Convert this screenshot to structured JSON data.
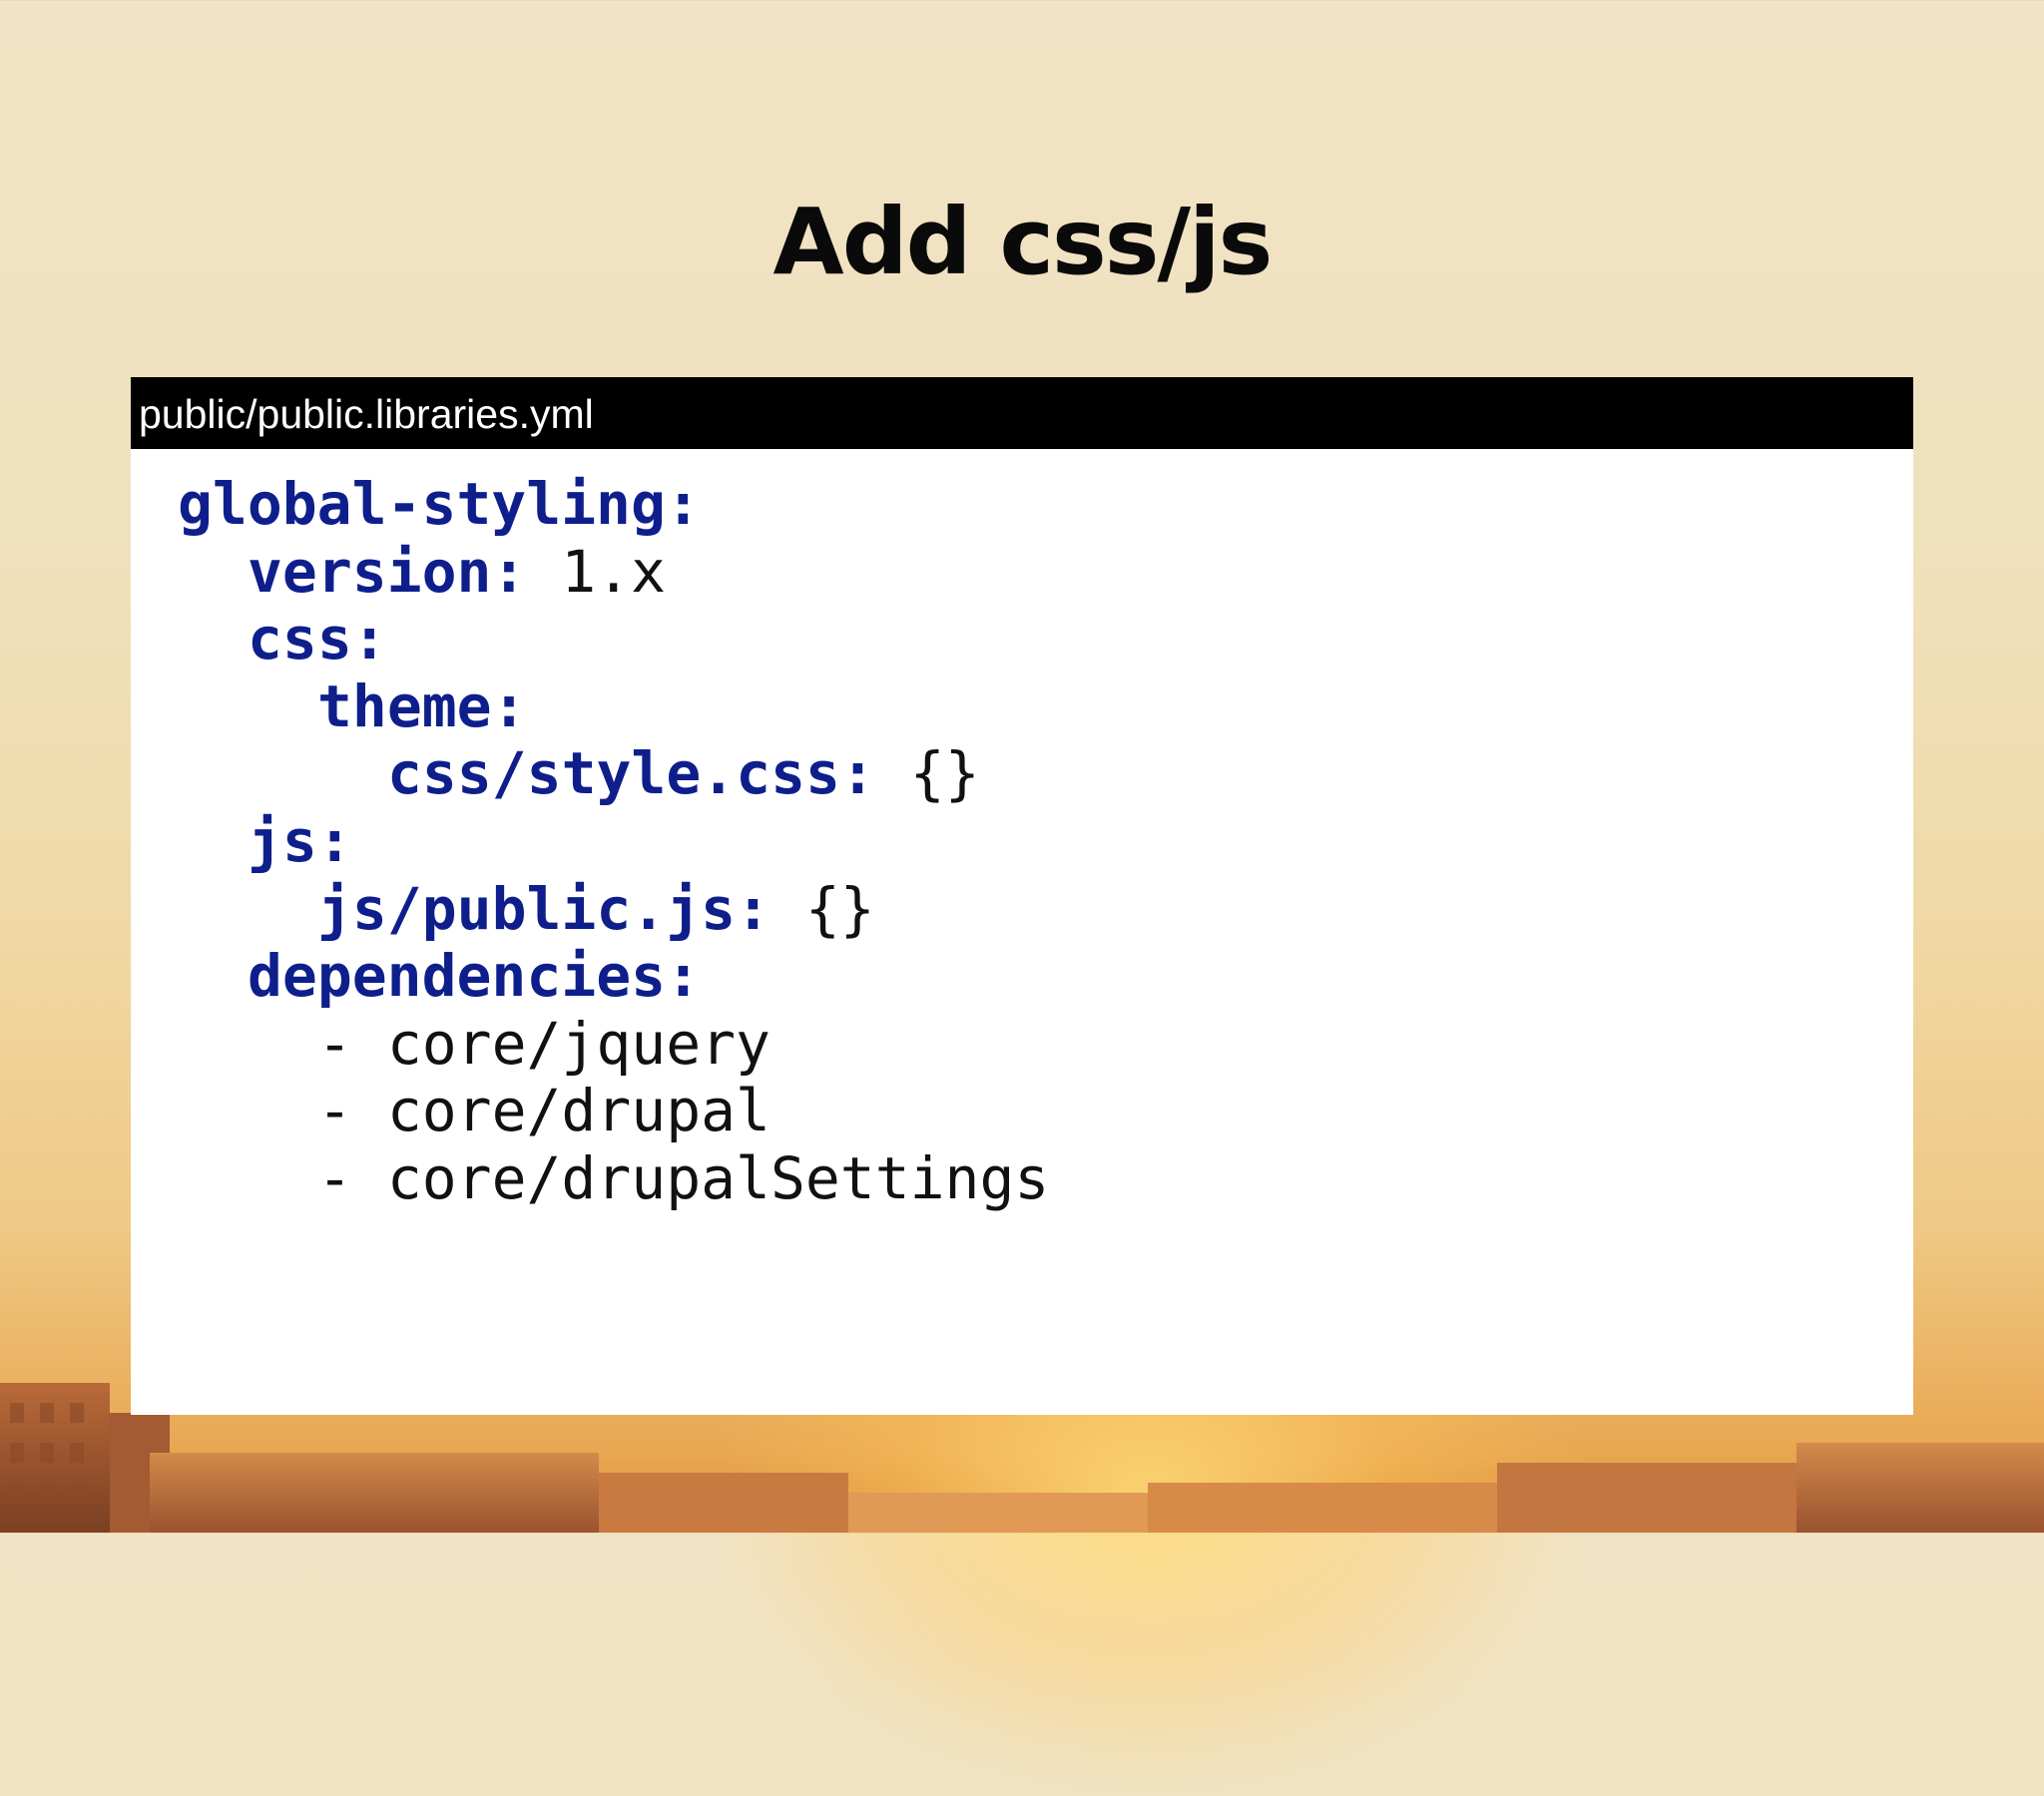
{
  "slide": {
    "title": "Add css/js"
  },
  "code_panel": {
    "filename": "public/public.libraries.yml",
    "lines": [
      {
        "key": "global-styling:",
        "value": ""
      },
      {
        "key": "version: ",
        "value": "1.x"
      },
      {
        "key": "css:",
        "value": ""
      },
      {
        "key": "theme:",
        "value": ""
      },
      {
        "key": "css/style.css: ",
        "value": "{}"
      },
      {
        "key": "js:",
        "value": ""
      },
      {
        "key": "js/public.js: ",
        "value": "{}"
      },
      {
        "key": "dependencies:",
        "value": ""
      },
      {
        "key": "",
        "value": "- core/jquery"
      },
      {
        "key": "",
        "value": "- core/drupal"
      },
      {
        "key": "",
        "value": "- core/drupalSettings"
      }
    ]
  },
  "colors": {
    "key_color": "#0e1f8c",
    "file_bar_background": "#000000",
    "panel_background": "#ffffff"
  }
}
